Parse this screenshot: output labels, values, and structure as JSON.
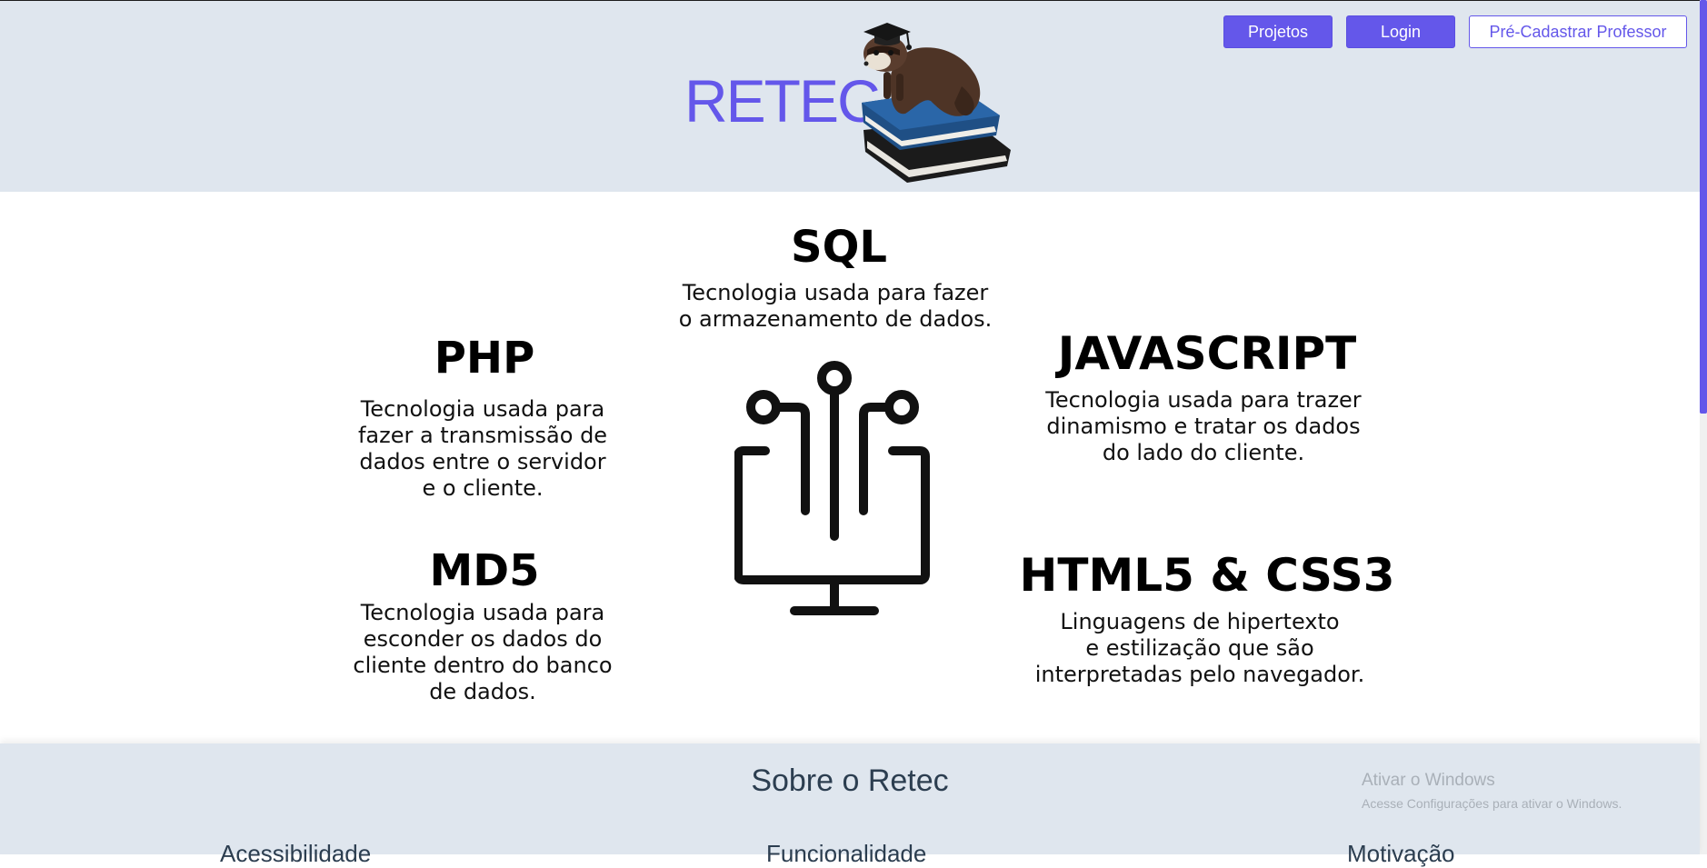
{
  "header": {
    "brand": "RETEC",
    "nav": {
      "projetos": "Projetos",
      "login": "Login",
      "pre_cadastrar": "Pré-Cadastrar Professor"
    }
  },
  "technologies": {
    "sql": {
      "title": "SQL",
      "desc": "Tecnologia usada para fazer\no armazenamento de dados."
    },
    "php": {
      "title": "PHP",
      "desc": "Tecnologia usada para\nfazer a transmissão de\ndados entre o servidor\ne o cliente."
    },
    "javascript": {
      "title": "JAVASCRIPT",
      "desc": "Tecnologia usada para trazer\ndinamismo e tratar os dados\ndo lado do cliente."
    },
    "md5": {
      "title": "MD5",
      "desc": "Tecnologia usada para\nesconder os dados do\ncliente dentro do banco\nde dados."
    },
    "html_css": {
      "title": "HTML5 & CSS3",
      "desc": "Linguagens de hipertexto\ne estilização que são\ninterpretadas pelo navegador."
    }
  },
  "footer": {
    "title": "Sobre o Retec",
    "columns": [
      "Acessibilidade",
      "Funcionalidade",
      "Motivação"
    ]
  },
  "watermark": {
    "line1": "Ativar o Windows",
    "line2": "Acesse Configurações para ativar o Windows."
  },
  "colors": {
    "accent": "#6457ea",
    "header_bg": "#dfe6ee"
  },
  "icons": {
    "mascot": "ferret-graduate-on-books",
    "center": "circuit-monitor-icon"
  }
}
